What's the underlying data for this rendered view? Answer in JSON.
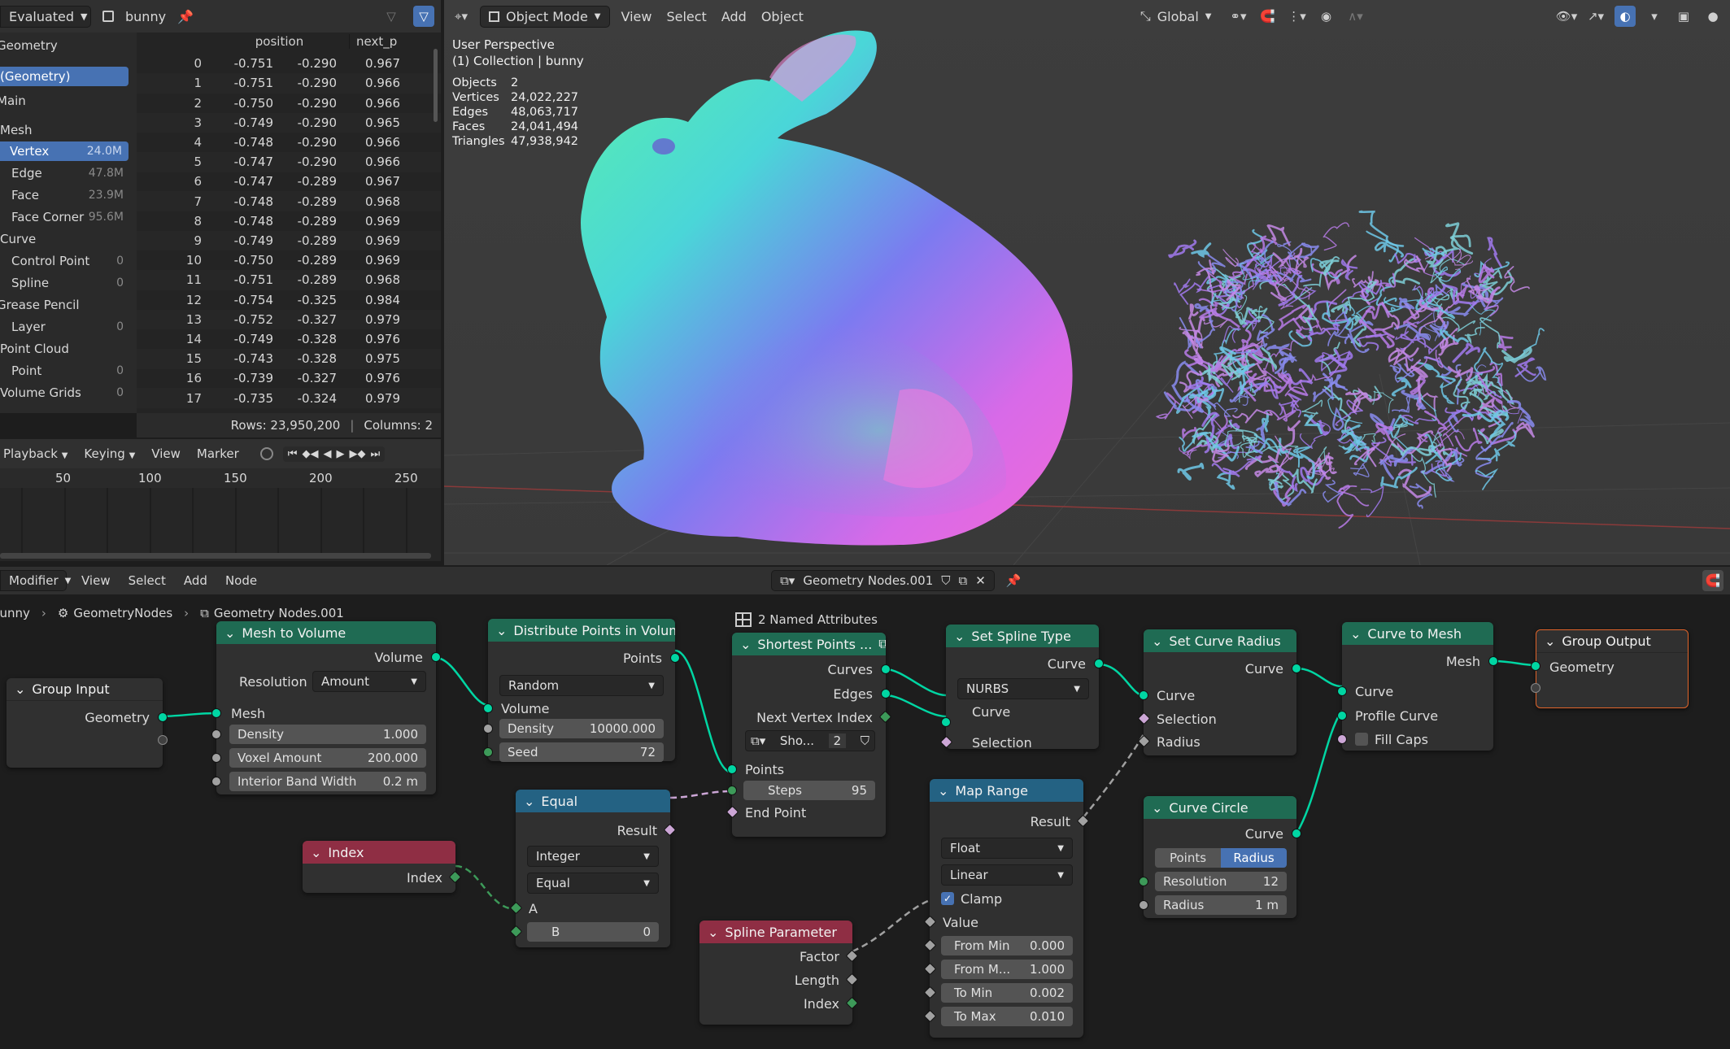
{
  "spreadsheet": {
    "header": {
      "mode": "Evaluated",
      "object": "bunny"
    },
    "sidebar": {
      "geometry_label": "Geometry",
      "geometry_item": "(Geometry)",
      "main_label": "Main",
      "mesh_label": "Mesh",
      "items": [
        {
          "label": "Vertex",
          "count": "24.0M"
        },
        {
          "label": "Edge",
          "count": "47.8M"
        },
        {
          "label": "Face",
          "count": "23.9M"
        },
        {
          "label": "Face Corner",
          "count": "95.6M"
        }
      ],
      "curve_label": "Curve",
      "curve_items": [
        {
          "label": "Control Point",
          "count": "0"
        },
        {
          "label": "Spline",
          "count": "0"
        }
      ],
      "grease_label": "Grease Pencil",
      "grease_items": [
        {
          "label": "Layer",
          "count": "0"
        }
      ],
      "pointcloud_label": "Point Cloud",
      "pointcloud_items": [
        {
          "label": "Point",
          "count": "0"
        }
      ],
      "volume_label": "Volume Grids",
      "volume_count": "0"
    },
    "columns": [
      "position",
      "next_p"
    ],
    "rows": [
      [
        "0",
        "-0.751",
        "-0.290",
        "0.967"
      ],
      [
        "1",
        "-0.751",
        "-0.290",
        "0.966"
      ],
      [
        "2",
        "-0.750",
        "-0.290",
        "0.966"
      ],
      [
        "3",
        "-0.749",
        "-0.290",
        "0.965"
      ],
      [
        "4",
        "-0.748",
        "-0.290",
        "0.966"
      ],
      [
        "5",
        "-0.747",
        "-0.290",
        "0.966"
      ],
      [
        "6",
        "-0.747",
        "-0.289",
        "0.967"
      ],
      [
        "7",
        "-0.748",
        "-0.289",
        "0.968"
      ],
      [
        "8",
        "-0.748",
        "-0.289",
        "0.969"
      ],
      [
        "9",
        "-0.749",
        "-0.289",
        "0.969"
      ],
      [
        "10",
        "-0.750",
        "-0.289",
        "0.969"
      ],
      [
        "11",
        "-0.751",
        "-0.289",
        "0.968"
      ],
      [
        "12",
        "-0.754",
        "-0.325",
        "0.984"
      ],
      [
        "13",
        "-0.752",
        "-0.327",
        "0.979"
      ],
      [
        "14",
        "-0.749",
        "-0.328",
        "0.976"
      ],
      [
        "15",
        "-0.743",
        "-0.328",
        "0.975"
      ],
      [
        "16",
        "-0.739",
        "-0.327",
        "0.976"
      ],
      [
        "17",
        "-0.735",
        "-0.324",
        "0.979"
      ]
    ],
    "footer": {
      "rows": "Rows: 23,950,200",
      "columns": "Columns: 2"
    }
  },
  "timeline": {
    "menus": [
      "Playback",
      "Keying",
      "View",
      "Marker"
    ],
    "ticks": [
      "50",
      "100",
      "150",
      "200",
      "250"
    ]
  },
  "viewport": {
    "header": {
      "mode": "Object Mode",
      "menus": [
        "View",
        "Select",
        "Add",
        "Object"
      ],
      "orientation": "Global"
    },
    "overlay": {
      "title": "User Perspective",
      "collection": "(1) Collection | bunny",
      "stats": [
        {
          "label": "Objects",
          "value": "2"
        },
        {
          "label": "Vertices",
          "value": "24,022,227"
        },
        {
          "label": "Edges",
          "value": "48,063,717"
        },
        {
          "label": "Faces",
          "value": "24,041,494"
        },
        {
          "label": "Triangles",
          "value": "47,938,942"
        }
      ]
    }
  },
  "node_editor": {
    "header": {
      "editor_type": "Modifier",
      "menus": [
        "View",
        "Select",
        "Add",
        "Node"
      ],
      "tree_name": "Geometry Nodes.001"
    },
    "breadcrumb": [
      "bunny",
      "GeometryNodes",
      "Geometry Nodes.001"
    ],
    "nodes": {
      "group_input": {
        "title": "Group Input",
        "geometry": "Geometry"
      },
      "mesh_to_volume": {
        "title": "Mesh to Volume",
        "volume": "Volume",
        "resolution_label": "Resolution",
        "resolution": "Amount",
        "mesh": "Mesh",
        "density_label": "Density",
        "density": "1.000",
        "voxel_label": "Voxel Amount",
        "voxel": "200.000",
        "band_label": "Interior Band Width",
        "band": "0.2 m"
      },
      "distribute": {
        "title": "Distribute Points in Volume",
        "points": "Points",
        "mode": "Random",
        "volume": "Volume",
        "density_label": "Density",
        "density": "10000.000",
        "seed_label": "Seed",
        "seed": "72"
      },
      "named_attr": {
        "title": "2 Named Attributes"
      },
      "shortest": {
        "title": "Shortest Points ...",
        "curves": "Curves",
        "edges": "Edges",
        "next_vertex": "Next Vertex Index",
        "sub": "Sho...",
        "sub_count": "2",
        "points": "Points",
        "steps_label": "Steps",
        "steps": "95",
        "end_point": "End Point"
      },
      "set_spline_type": {
        "title": "Set Spline Type",
        "curve_out": "Curve",
        "type": "NURBS",
        "curve_in": "Curve",
        "selection": "Selection"
      },
      "set_curve_radius": {
        "title": "Set Curve Radius",
        "curve_out": "Curve",
        "curve_in": "Curve",
        "selection": "Selection",
        "radius": "Radius"
      },
      "curve_to_mesh": {
        "title": "Curve to Mesh",
        "mesh": "Mesh",
        "curve": "Curve",
        "profile": "Profile Curve",
        "fill_caps": "Fill Caps"
      },
      "group_output": {
        "title": "Group Output",
        "geometry": "Geometry"
      },
      "equal": {
        "title": "Equal",
        "result": "Result",
        "type": "Integer",
        "op": "Equal",
        "a": "A",
        "b_label": "B",
        "b": "0"
      },
      "index": {
        "title": "Index",
        "index": "Index"
      },
      "map_range": {
        "title": "Map Range",
        "result": "Result",
        "type": "Float",
        "interp": "Linear",
        "clamp": "Clamp",
        "value": "Value",
        "from_min_label": "From Min",
        "from_min": "0.000",
        "from_max_label": "From M...",
        "from_max": "1.000",
        "to_min_label": "To Min",
        "to_min": "0.002",
        "to_max_label": "To Max",
        "to_max": "0.010"
      },
      "spline_param": {
        "title": "Spline Parameter",
        "factor": "Factor",
        "length": "Length",
        "index": "Index"
      },
      "curve_circle": {
        "title": "Curve Circle",
        "curve": "Curve",
        "mode_points": "Points",
        "mode_radius": "Radius",
        "resolution_label": "Resolution",
        "resolution": "12",
        "radius_label": "Radius",
        "radius": "1 m"
      }
    }
  },
  "colors": {
    "geometry_header": "#1f6b53",
    "converter_header": "#246283",
    "input_header": "#8f2e44",
    "selected": "#4772b3",
    "geometry_socket": "#00d6a3"
  }
}
